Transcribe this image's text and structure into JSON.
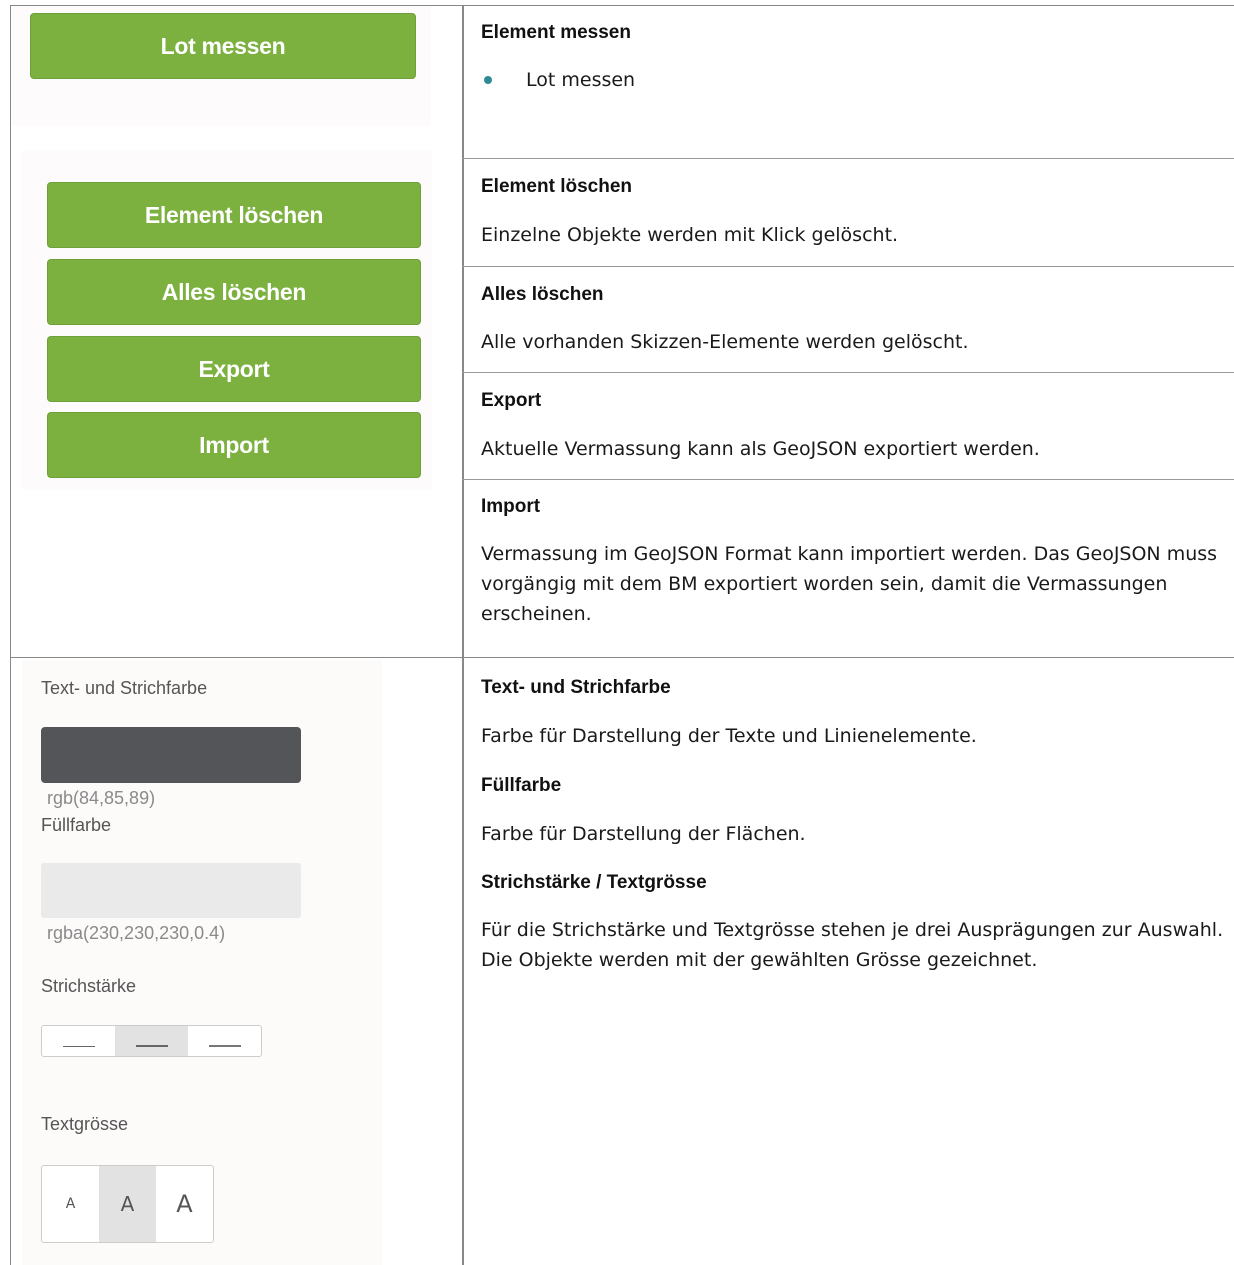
{
  "left": {
    "lot_button": "Lot messen",
    "buttons": [
      "Element löschen",
      "Alles löschen",
      "Export",
      "Import"
    ],
    "style_panel": {
      "stroke_color_label": "Text- und Strichfarbe",
      "stroke_color_value": "rgb(84,85,89)",
      "fill_color_label": "Füllfarbe",
      "fill_color_value": "rgba(230,230,230,0.4)",
      "stroke_width_label": "Strichstärke",
      "stroke_width_selected": 2,
      "text_size_label": "Textgrösse",
      "text_size_options": [
        "A",
        "A",
        "A"
      ],
      "text_size_selected": 2
    }
  },
  "right": {
    "measure": {
      "title": "Element messen",
      "items": [
        "Lot messen"
      ]
    },
    "delete_element": {
      "title": "Element löschen",
      "text": "Einzelne Objekte werden mit Klick gelöscht."
    },
    "delete_all": {
      "title": "Alles löschen",
      "text": "Alle vorhanden Skizzen-Elemente werden gelöscht."
    },
    "export": {
      "title": "Export",
      "text": "Aktuelle Vermassung kann als GeoJSON exportiert werden."
    },
    "import": {
      "title": "Import",
      "text": "Vermassung im GeoJSON Format kann importiert werden. Das GeoJSON muss vorgängig mit dem BM exportiert worden sein, damit die Vermassungen erscheinen."
    },
    "stroke_color": {
      "title": "Text- und Strichfarbe",
      "text": "Farbe für Darstellung der Texte und Linienelemente."
    },
    "fill_color": {
      "title": "Füllfarbe",
      "text": "Farbe für Darstellung der Flächen."
    },
    "stroke_text_size": {
      "title": "Strichstärke / Textgrösse",
      "text": "Für die Strichstärke und Textgrösse stehen je drei Ausprägungen zur Auswahl. Die Objekte werden mit der gewählten Grösse gezeichnet."
    }
  },
  "colors": {
    "button_green": "#7cb140",
    "bullet_teal": "#2f8a96",
    "stroke_swatch": "rgb(84,85,89)",
    "fill_swatch": "rgba(230,230,230,0.4)"
  }
}
